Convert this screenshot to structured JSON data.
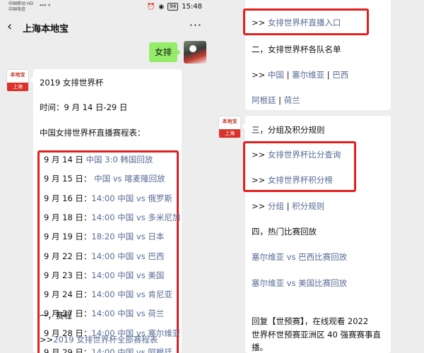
{
  "status_bar": {
    "carrier1": "中国移动",
    "carrier1_badge": "HD",
    "carrier2": "中国电信",
    "signal": "⁴⁶ᴵˡˡ ᴵˡˡ",
    "battery": "94",
    "time": "15:48"
  },
  "nav": {
    "back_icon": "‹",
    "title": "上海本地宝",
    "more_icon": "···"
  },
  "user_message": "女排",
  "bot_avatar": {
    "logo": "本地宝",
    "city": "上海"
  },
  "left_card": {
    "title": "2019 女排世界杯",
    "time_line": "时间：9 月 14 日-29 日",
    "schedule_heading": "中国女排世界杯直播赛程表：",
    "schedule": [
      {
        "date": "9 月 14 日",
        "sep": "",
        "time": "",
        "match": "中国 3:0 韩国回放"
      },
      {
        "date": "9 月 15 日",
        "sep": "：",
        "time": "",
        "match": "中国 vs 喀麦隆回放"
      },
      {
        "date": "9 月 16 日",
        "sep": "：",
        "time": "14:00",
        "match": "中国 vs 俄罗斯"
      },
      {
        "date": "9 月 18 日",
        "sep": "：",
        "time": "14:00",
        "match": "中国 vs 多米尼加"
      },
      {
        "date": "9 月 19 日",
        "sep": "：",
        "time": "18:20",
        "match": "中国 vs 日本"
      },
      {
        "date": "9 月 22 日",
        "sep": "：",
        "time": "14:00",
        "match": "中国 vs 巴西"
      },
      {
        "date": "9 月 23 日",
        "sep": "：",
        "time": "14:00",
        "match": "中国 vs 美国"
      },
      {
        "date": "9 月 24 日",
        "sep": "：",
        "time": "14:00",
        "match": "中国 vs 肯尼亚"
      },
      {
        "date": "9 月 27 日",
        "sep": "：",
        "time": "14:00",
        "match": "中国 vs 荷兰"
      },
      {
        "date": "9 月 28 日",
        "sep": "：",
        "time": "14:00",
        "match": "中国 vs 塞尔维亚"
      },
      {
        "date": "9 月 29 日",
        "sep": "：",
        "time": "14:00",
        "match": "中国 vs 阿根廷"
      }
    ],
    "section1": "一，赛程",
    "full_schedule_prefix": ">>",
    "full_schedule_link": "2019 女排世界杯全部赛程表"
  },
  "right_card_top": {
    "live_prefix": ">> ",
    "live_link": "女排世界杯直播入口",
    "section2": "二，女排世界杯各队名单",
    "teams_prefix": ">> ",
    "teams": [
      "中国",
      "塞尔维亚",
      "巴西",
      "阿根廷",
      "荷兰"
    ],
    "divider": " | "
  },
  "right_card_bottom": {
    "section3": "三，分组及积分规则",
    "score_prefix": ">> ",
    "score_link": "女排世界杯比分查询",
    "standing_prefix": ">> ",
    "standing_link": "女排世界杯积分榜",
    "group_prefix": ">> ",
    "group_link": "分组",
    "divider": " | ",
    "rules_link": "积分规则",
    "section4": "四，热门比赛回放",
    "replay1": "塞尔维亚 vs 巴西比赛回放",
    "replay2": "塞尔维亚 vs 美国比赛回放",
    "footer_line1": "回复【世预赛】，在线观看 2022",
    "footer_line2": "世界杯世预赛亚洲区 40 强赛赛事直",
    "footer_line3": "播。"
  },
  "colors": {
    "link": "#576b95",
    "highlight_border": "#e41e1e",
    "bubble": "#95ec69"
  }
}
